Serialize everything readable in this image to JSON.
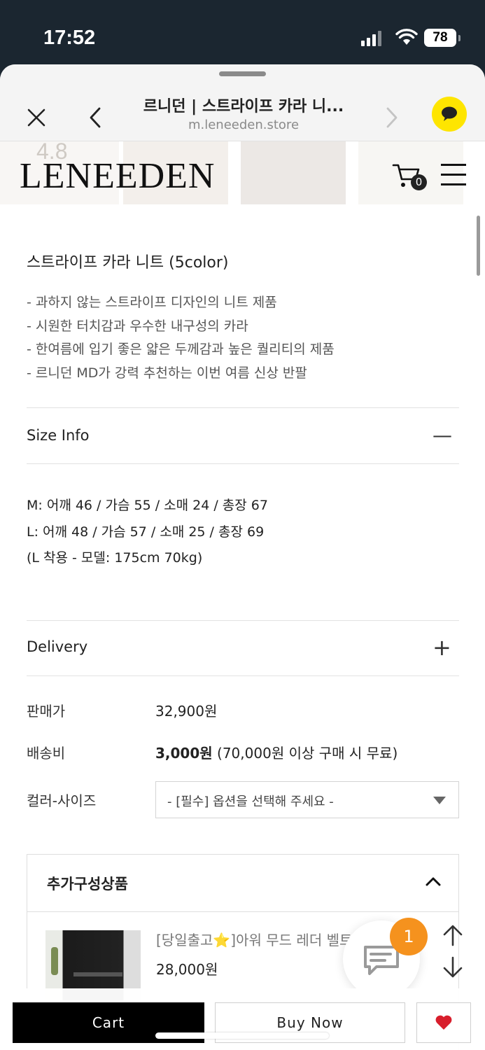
{
  "status_bar": {
    "time": "17:52",
    "battery": "78"
  },
  "browser": {
    "title": "르니던 | 스트라이프 카라 니...",
    "url": "m.leneeden.store"
  },
  "site": {
    "logo": "LENEEDEN",
    "rating_ghost": "4.8",
    "cart_count": "0"
  },
  "product": {
    "name": "스트라이프 카라 니트 (5color)",
    "description": [
      "- 과하지 않는 스트라이프 디자인의 니트 제품",
      "- 시원한 터치감과 우수한 내구성의 카라",
      "- 한여름에 입기 좋은 얇은 두께감과 높은 퀄리티의 제품",
      "- 르니던 MD가 강력 추천하는 이번 여름 신상 반팔"
    ]
  },
  "size_info": {
    "title": "Size Info",
    "toggle": "—",
    "lines": [
      "M: 어깨 46 / 가슴 55 / 소매 24 / 총장 67",
      "L: 어깨 48 / 가슴 57 / 소매 25 / 총장 69",
      "(L 착용 - 모델: 175cm 70kg)"
    ]
  },
  "delivery": {
    "title": "Delivery",
    "toggle": "+"
  },
  "pricing": {
    "price_label": "판매가",
    "price_value": "32,900원",
    "shipping_label": "배송비",
    "shipping_value": "3,000원",
    "shipping_note": " (70,000원 이상 구매 시 무료)",
    "option_label": "컬러-사이즈",
    "option_placeholder": "- [필수] 옵션을 선택해 주세요 -"
  },
  "addon": {
    "title": "추가구성상품",
    "item_name": "[당일출고⭐]아워 무드 레더 벨트",
    "item_price": "28,000원"
  },
  "floating": {
    "badge": "1"
  },
  "bottom": {
    "cart": "Cart",
    "buy_now": "Buy Now"
  },
  "colors": {
    "accent_badge": "#f5921e",
    "kakao": "#fee500",
    "heart": "#d81e2c"
  }
}
